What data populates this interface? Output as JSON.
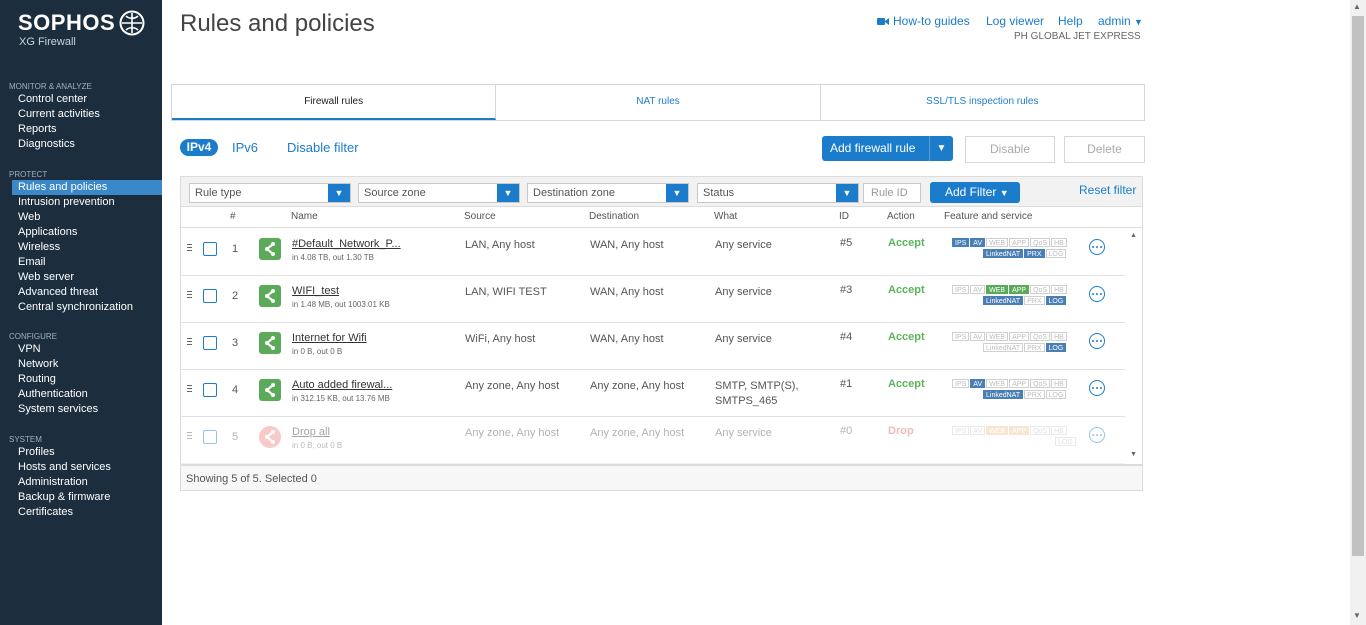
{
  "brand": {
    "name": "SOPHOS",
    "product": "XG Firewall"
  },
  "sidebar": {
    "sections": [
      {
        "heading": "MONITOR & ANALYZE",
        "items": [
          "Control center",
          "Current activities",
          "Reports",
          "Diagnostics"
        ]
      },
      {
        "heading": "PROTECT",
        "items": [
          "Rules and policies",
          "Intrusion prevention",
          "Web",
          "Applications",
          "Wireless",
          "Email",
          "Web server",
          "Advanced threat",
          "Central synchronization"
        ]
      },
      {
        "heading": "CONFIGURE",
        "items": [
          "VPN",
          "Network",
          "Routing",
          "Authentication",
          "System services"
        ]
      },
      {
        "heading": "SYSTEM",
        "items": [
          "Profiles",
          "Hosts and services",
          "Administration",
          "Backup & firmware",
          "Certificates"
        ]
      }
    ],
    "active_item": "Rules and policies"
  },
  "header": {
    "title": "Rules and policies",
    "howto": "How-to guides",
    "log_viewer": "Log viewer",
    "help": "Help",
    "user": "admin",
    "company": "PH GLOBAL JET EXPRESS"
  },
  "tabs": [
    "Firewall rules",
    "NAT rules",
    "SSL/TLS inspection rules"
  ],
  "active_tab": "Firewall rules",
  "toolbar": {
    "ipv4": "IPv4",
    "ipv6": "IPv6",
    "disable_filter": "Disable filter",
    "add_rule": "Add firewall rule",
    "disable": "Disable",
    "delete": "Delete"
  },
  "filters": {
    "rule_type": "Rule type",
    "source_zone": "Source zone",
    "destination_zone": "Destination zone",
    "status": "Status",
    "rule_id_placeholder": "Rule ID",
    "add_filter": "Add Filter",
    "reset_filter": "Reset filter"
  },
  "table": {
    "columns": [
      "#",
      "Name",
      "Source",
      "Destination",
      "What",
      "ID",
      "Action",
      "Feature and service"
    ],
    "rows": [
      {
        "num": "1",
        "name": "#Default_Network_P...",
        "stats": "in 4.08 TB, out 1.30 TB",
        "source": "LAN, Any host",
        "destination": "WAN, Any host",
        "what": "Any service",
        "id": "#5",
        "action": "Accept",
        "enabled": true,
        "badges_line1": [
          [
            "IPS",
            "blue"
          ],
          [
            "AV",
            "blue"
          ],
          [
            "WEB",
            "off"
          ],
          [
            "APP",
            "off"
          ],
          [
            "QoS",
            "off"
          ],
          [
            "HB",
            "off"
          ]
        ],
        "badges_line2": [
          [
            "LinkedNAT",
            "blue"
          ],
          [
            "PRX",
            "blue"
          ],
          [
            "LOG",
            "off"
          ]
        ]
      },
      {
        "num": "2",
        "name": "WIFI_test",
        "stats": "in 1.48 MB, out 1003.01 KB",
        "source": "LAN, WIFI TEST",
        "destination": "WAN, Any host",
        "what": "Any service",
        "id": "#3",
        "action": "Accept",
        "enabled": true,
        "badges_line1": [
          [
            "IPS",
            "off"
          ],
          [
            "AV",
            "off"
          ],
          [
            "WEB",
            "green"
          ],
          [
            "APP",
            "green"
          ],
          [
            "QoS",
            "off"
          ],
          [
            "HB",
            "off"
          ]
        ],
        "badges_line2": [
          [
            "LinkedNAT",
            "blue"
          ],
          [
            "PRX",
            "off"
          ],
          [
            "LOG",
            "blue"
          ]
        ]
      },
      {
        "num": "3",
        "name": "Internet for Wifi",
        "stats": "in 0 B, out 0 B",
        "source": "WiFi, Any host",
        "destination": "WAN, Any host",
        "what": "Any service",
        "id": "#4",
        "action": "Accept",
        "enabled": true,
        "badges_line1": [
          [
            "IPS",
            "off"
          ],
          [
            "AV",
            "off"
          ],
          [
            "WEB",
            "off"
          ],
          [
            "APP",
            "off"
          ],
          [
            "QoS",
            "off"
          ],
          [
            "HB",
            "off"
          ]
        ],
        "badges_line2": [
          [
            "LinkedNAT",
            "off"
          ],
          [
            "PRX",
            "off"
          ],
          [
            "LOG",
            "blue"
          ]
        ]
      },
      {
        "num": "4",
        "name": "Auto added firewal...",
        "stats": "in 312.15 KB, out 13.76 MB",
        "source": "Any zone, Any host",
        "destination": "Any zone, Any host",
        "what": "SMTP, SMTP(S),",
        "what2": "SMTPS_465",
        "id": "#1",
        "action": "Accept",
        "enabled": true,
        "badges_line1": [
          [
            "IPS",
            "off"
          ],
          [
            "AV",
            "blue"
          ],
          [
            "WEB",
            "off"
          ],
          [
            "APP",
            "off"
          ],
          [
            "QoS",
            "off"
          ],
          [
            "HB",
            "off"
          ]
        ],
        "badges_line2": [
          [
            "LinkedNAT",
            "blue"
          ],
          [
            "PRX",
            "off"
          ],
          [
            "LOG",
            "off"
          ]
        ]
      },
      {
        "num": "5",
        "name": "Drop all",
        "stats": "in 0 B, out 0 B",
        "source": "Any zone, Any host",
        "destination": "Any zone, Any host",
        "what": "Any service",
        "id": "#0",
        "action": "Drop",
        "enabled": false,
        "badges_line1": [
          [
            "IPS",
            "off"
          ],
          [
            "AV",
            "off"
          ],
          [
            "WEB",
            "orange"
          ],
          [
            "APP",
            "orange"
          ],
          [
            "QoS",
            "off"
          ],
          [
            "HB",
            "off"
          ]
        ],
        "badges_line2": [
          [
            "LOG",
            "off"
          ]
        ]
      }
    ]
  },
  "footer": "Showing 5 of 5. Selected 0"
}
